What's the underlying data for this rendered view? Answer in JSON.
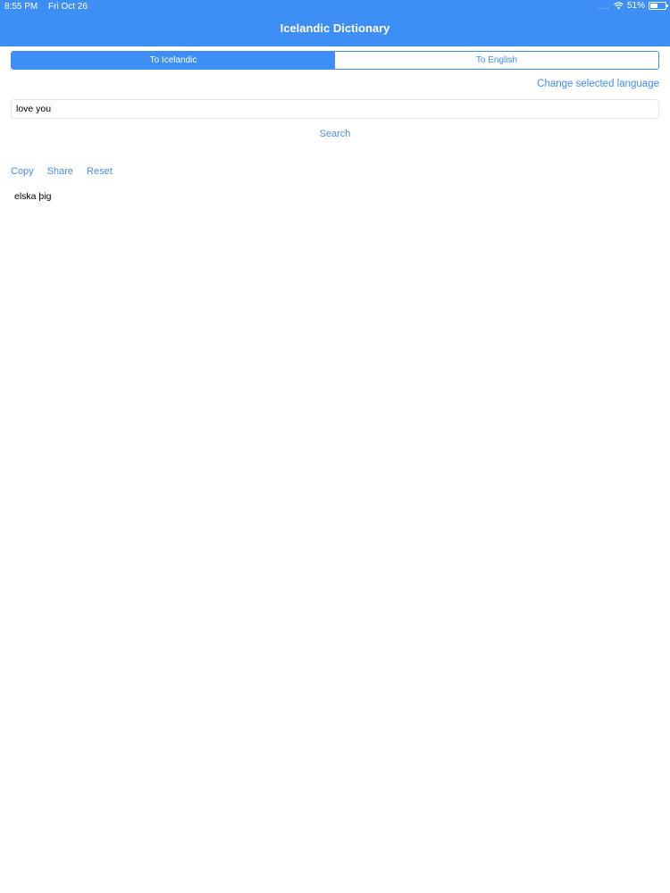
{
  "status_bar": {
    "time": "8:55 PM",
    "date": "Fri Oct 26",
    "signal": "....",
    "battery_percent": "51%",
    "battery_level": 0.51
  },
  "header": {
    "title": "Icelandic Dictionary"
  },
  "segmented_control": {
    "options": [
      "To Icelandic",
      "To English"
    ],
    "selected_index": 0
  },
  "change_language_label": "Change selected language",
  "search": {
    "value": "love you",
    "button_label": "Search"
  },
  "actions": {
    "copy": "Copy",
    "share": "Share",
    "reset": "Reset"
  },
  "result": {
    "text": "elska þig"
  },
  "colors": {
    "accent": "#3d8ef5",
    "link": "#4a8fe7",
    "background": "#ffffff"
  },
  "icons": {
    "wifi": "wifi-icon",
    "battery": "battery-icon"
  }
}
